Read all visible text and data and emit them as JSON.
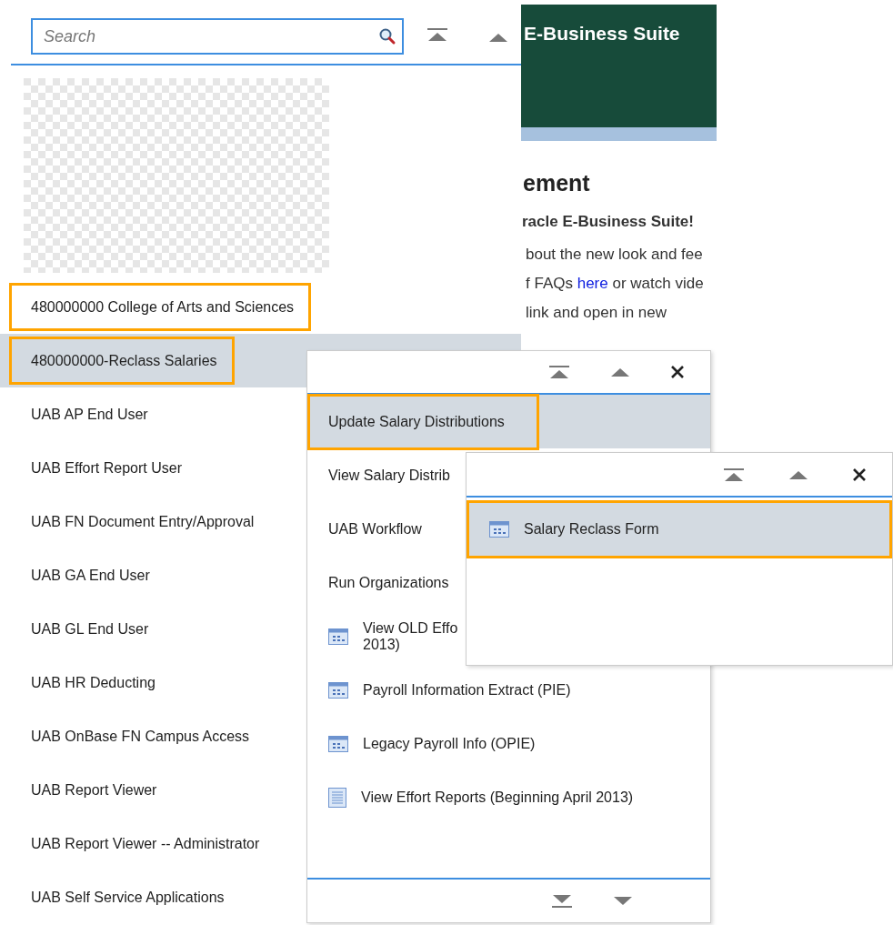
{
  "search": {
    "placeholder": "Search"
  },
  "navigator": {
    "items": [
      {
        "label": "480000000 College of Arts and Sciences",
        "selected": false,
        "highlighted": true
      },
      {
        "label": "480000000-Reclass Salaries",
        "selected": true,
        "highlighted": true
      },
      {
        "label": "UAB AP End User",
        "selected": false,
        "highlighted": false
      },
      {
        "label": "UAB Effort Report User",
        "selected": false,
        "highlighted": false
      },
      {
        "label": "UAB FN Document Entry/Approval",
        "selected": false,
        "highlighted": false
      },
      {
        "label": "UAB GA End User",
        "selected": false,
        "highlighted": false
      },
      {
        "label": "UAB GL End User",
        "selected": false,
        "highlighted": false
      },
      {
        "label": "UAB HR Deducting",
        "selected": false,
        "highlighted": false
      },
      {
        "label": "UAB OnBase FN Campus Access",
        "selected": false,
        "highlighted": false
      },
      {
        "label": "UAB Report Viewer",
        "selected": false,
        "highlighted": false
      },
      {
        "label": "UAB Report Viewer -- Administrator",
        "selected": false,
        "highlighted": false
      },
      {
        "label": "UAB Self Service Applications",
        "selected": false,
        "highlighted": false
      }
    ]
  },
  "background_page": {
    "header_title": "E-Business Suite",
    "heading": "ement",
    "subheading": "racle E-Business Suite!",
    "lines": [
      {
        "text": "bout the new look and fee"
      },
      {
        "text": "f FAQs ",
        "link": "here",
        "after": " or watch vide"
      },
      {
        "text": "link and open in new"
      }
    ]
  },
  "submenu": {
    "items": [
      {
        "label": "Update Salary Distributions",
        "kind": "plain",
        "selected": true,
        "highlighted": true
      },
      {
        "label": "View Salary Distrib",
        "kind": "plain",
        "selected": false,
        "highlighted": false
      },
      {
        "label": "UAB Workflow",
        "kind": "plain",
        "selected": false,
        "highlighted": false
      },
      {
        "label": "Run Organizations",
        "kind": "plain",
        "selected": false,
        "highlighted": false
      },
      {
        "label": "View OLD Effo",
        "second_line": "2013)",
        "kind": "form",
        "selected": false,
        "highlighted": false
      },
      {
        "label": "Payroll Information Extract (PIE)",
        "kind": "form",
        "selected": false,
        "highlighted": false
      },
      {
        "label": "Legacy Payroll Info (OPIE)",
        "kind": "form",
        "selected": false,
        "highlighted": false
      },
      {
        "label": "View Effort Reports (Beginning April 2013)",
        "kind": "document",
        "selected": false,
        "highlighted": false
      }
    ]
  },
  "submenu_2": {
    "items": [
      {
        "label": "Salary Reclass Form",
        "kind": "form",
        "selected": true,
        "highlighted": true
      }
    ]
  }
}
